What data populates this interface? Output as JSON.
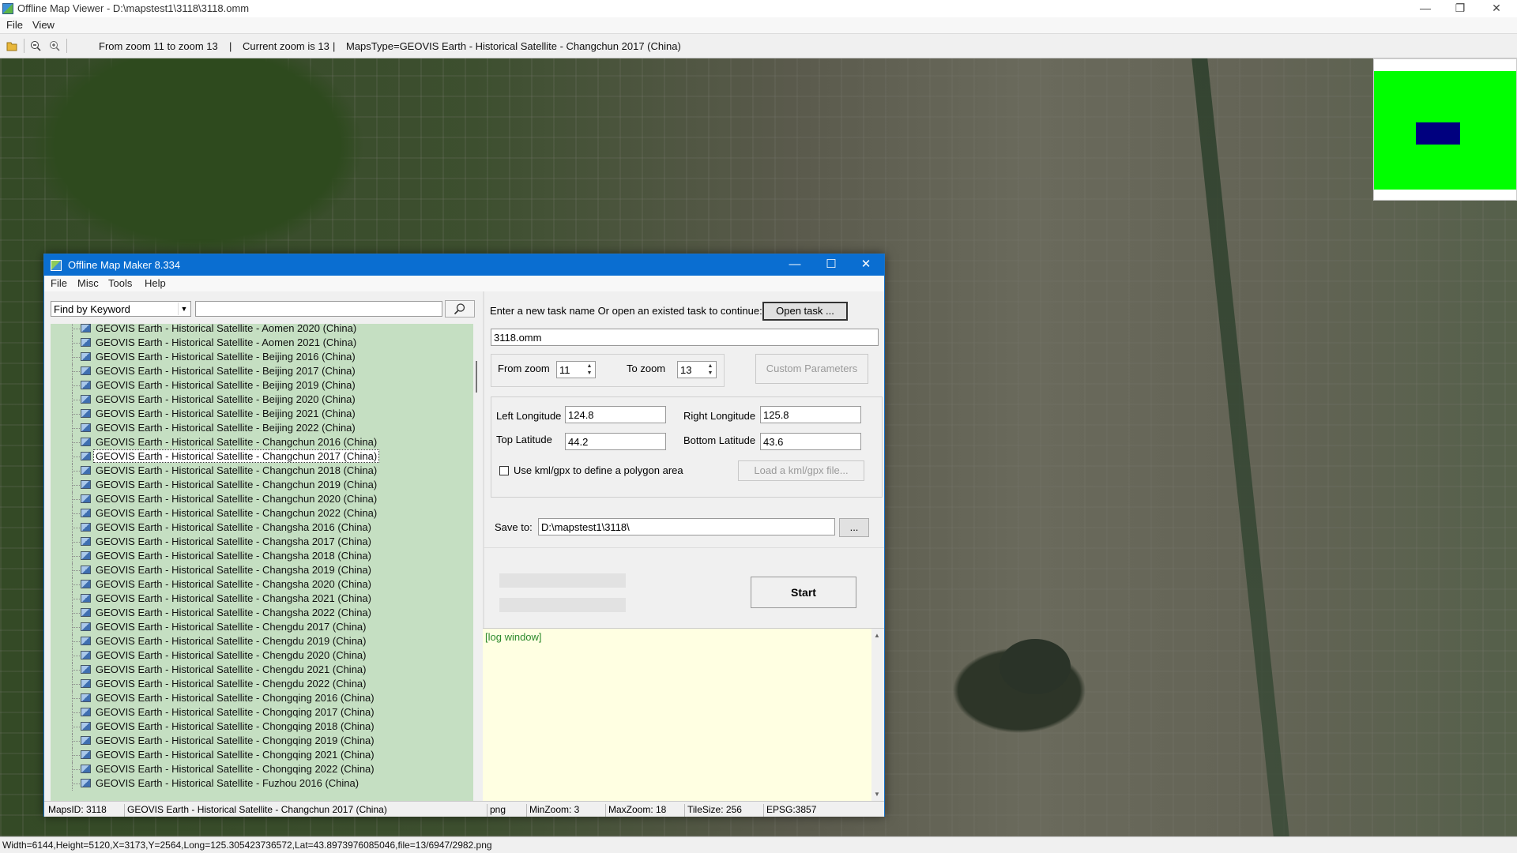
{
  "app": {
    "title": "Offline Map Viewer - D:\\mapstest1\\3118\\3118.omm",
    "menu": [
      "File",
      "View"
    ],
    "toolbar": {
      "zoom_range": "From zoom 11 to zoom 13",
      "current_zoom": "Current zoom is 13",
      "maps_type": "MapsType=GEOVIS Earth - Historical Satellite - Changchun 2017 (China)",
      "sep": "|"
    },
    "status": "Width=6144,Height=5120,X=3173,Y=2564,Long=125.305423736572,Lat=43.8973976085046,file=13/6947/2982.png",
    "window_controls": [
      "—",
      "❐",
      "✕"
    ]
  },
  "dialog": {
    "title": "Offline Map Maker 8.334",
    "menu": [
      "File",
      "Misc",
      "Tools",
      "Help"
    ],
    "window_controls": [
      "—",
      "☐",
      "✕"
    ],
    "search": {
      "mode": "Find by Keyword",
      "query": ""
    },
    "map_list": [
      "GEOVIS Earth - Historical Satellite - Aomen 2020 (China)",
      "GEOVIS Earth - Historical Satellite - Aomen 2021 (China)",
      "GEOVIS Earth - Historical Satellite - Beijing 2016 (China)",
      "GEOVIS Earth - Historical Satellite - Beijing 2017 (China)",
      "GEOVIS Earth - Historical Satellite - Beijing 2019 (China)",
      "GEOVIS Earth - Historical Satellite - Beijing 2020 (China)",
      "GEOVIS Earth - Historical Satellite - Beijing 2021 (China)",
      "GEOVIS Earth - Historical Satellite - Beijing 2022 (China)",
      "GEOVIS Earth - Historical Satellite - Changchun 2016 (China)",
      "GEOVIS Earth - Historical Satellite - Changchun 2017 (China)",
      "GEOVIS Earth - Historical Satellite - Changchun 2018 (China)",
      "GEOVIS Earth - Historical Satellite - Changchun 2019 (China)",
      "GEOVIS Earth - Historical Satellite - Changchun 2020 (China)",
      "GEOVIS Earth - Historical Satellite - Changchun 2022 (China)",
      "GEOVIS Earth - Historical Satellite - Changsha 2016 (China)",
      "GEOVIS Earth - Historical Satellite - Changsha 2017 (China)",
      "GEOVIS Earth - Historical Satellite - Changsha 2018 (China)",
      "GEOVIS Earth - Historical Satellite - Changsha 2019 (China)",
      "GEOVIS Earth - Historical Satellite - Changsha 2020 (China)",
      "GEOVIS Earth - Historical Satellite - Changsha 2021 (China)",
      "GEOVIS Earth - Historical Satellite - Changsha 2022 (China)",
      "GEOVIS Earth - Historical Satellite - Chengdu 2017 (China)",
      "GEOVIS Earth - Historical Satellite - Chengdu 2019 (China)",
      "GEOVIS Earth - Historical Satellite - Chengdu 2020 (China)",
      "GEOVIS Earth - Historical Satellite - Chengdu 2021 (China)",
      "GEOVIS Earth - Historical Satellite - Chengdu 2022 (China)",
      "GEOVIS Earth - Historical Satellite - Chongqing 2016 (China)",
      "GEOVIS Earth - Historical Satellite - Chongqing 2017 (China)",
      "GEOVIS Earth - Historical Satellite - Chongqing 2018 (China)",
      "GEOVIS Earth - Historical Satellite - Chongqing 2019 (China)",
      "GEOVIS Earth - Historical Satellite - Chongqing 2021 (China)",
      "GEOVIS Earth - Historical Satellite - Chongqing 2022 (China)",
      "GEOVIS Earth - Historical Satellite - Fuzhou 2016 (China)"
    ],
    "selected_index": 9,
    "task_prompt": "Enter a new task name Or open an existed task to continue:",
    "open_task_label": "Open task ...",
    "task_name": "3118.omm",
    "from_zoom_label": "From zoom",
    "from_zoom": "11",
    "to_zoom_label": "To zoom",
    "to_zoom": "13",
    "custom_params_label": "Custom Parameters",
    "left_lon_label": "Left Longitude",
    "left_lon": "124.8",
    "right_lon_label": "Right Longitude",
    "right_lon": "125.8",
    "top_lat_label": "Top Latitude",
    "top_lat": "44.2",
    "bottom_lat_label": "Bottom Latitude",
    "bottom_lat": "43.6",
    "kml_label": "Use kml/gpx to define a polygon area",
    "load_kml_label": "Load a kml/gpx file...",
    "save_to_label": "Save to:",
    "save_to": "D:\\mapstest1\\3118\\",
    "browse_label": "...",
    "start_label": "Start",
    "log_tag": "[log window]",
    "status": {
      "maps_id": "MapsID: 3118",
      "maps_name": "GEOVIS Earth - Historical Satellite - Changchun 2017 (China)",
      "format": "png",
      "min_zoom": "MinZoom: 3",
      "max_zoom": "MaxZoom: 18",
      "tile_size": "TileSize: 256",
      "epsg": "EPSG:3857"
    }
  },
  "colors": {
    "dialog_title_bg": "#0a6ed1",
    "list_bg": "#c5dfc2",
    "log_bg": "#ffffe2",
    "minimap_bg": "#00ff00",
    "minimap_view": "#00007f"
  }
}
